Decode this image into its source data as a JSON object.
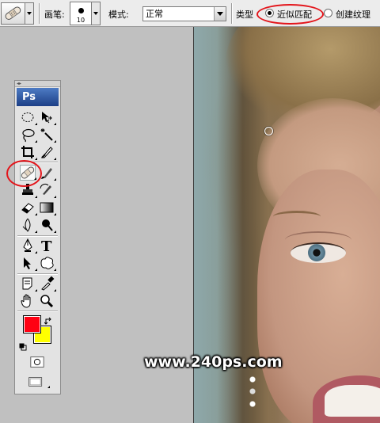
{
  "options_bar": {
    "tool_preset_icon": "bandage-icon",
    "brush_label": "画笔:",
    "brush_size": "10",
    "mode_label": "模式:",
    "mode_value": "正常",
    "type_label": "类型",
    "type_options": [
      {
        "label": "近似匹配",
        "checked": true
      },
      {
        "label": "创建纹理",
        "checked": false
      }
    ]
  },
  "palette": {
    "logo": "Ps",
    "tools": [
      "elliptical-marquee-icon",
      "move-icon",
      "lasso-icon",
      "magic-wand-icon",
      "crop-icon",
      "slice-icon",
      "spot-healing-brush-icon",
      "brush-icon",
      "clone-stamp-icon",
      "history-brush-icon",
      "eraser-icon",
      "gradient-icon",
      "blur-icon",
      "dodge-icon",
      "pen-icon",
      "type-icon",
      "path-selection-icon",
      "custom-shape-icon",
      "notes-icon",
      "eyedropper-icon",
      "hand-icon",
      "zoom-icon"
    ],
    "foreground_color": "#ff0012",
    "background_color": "#ffff00",
    "active_tool": "spot-healing-brush-icon"
  },
  "highlight_color": "#e3151b",
  "watermark": "www.240ps.com"
}
